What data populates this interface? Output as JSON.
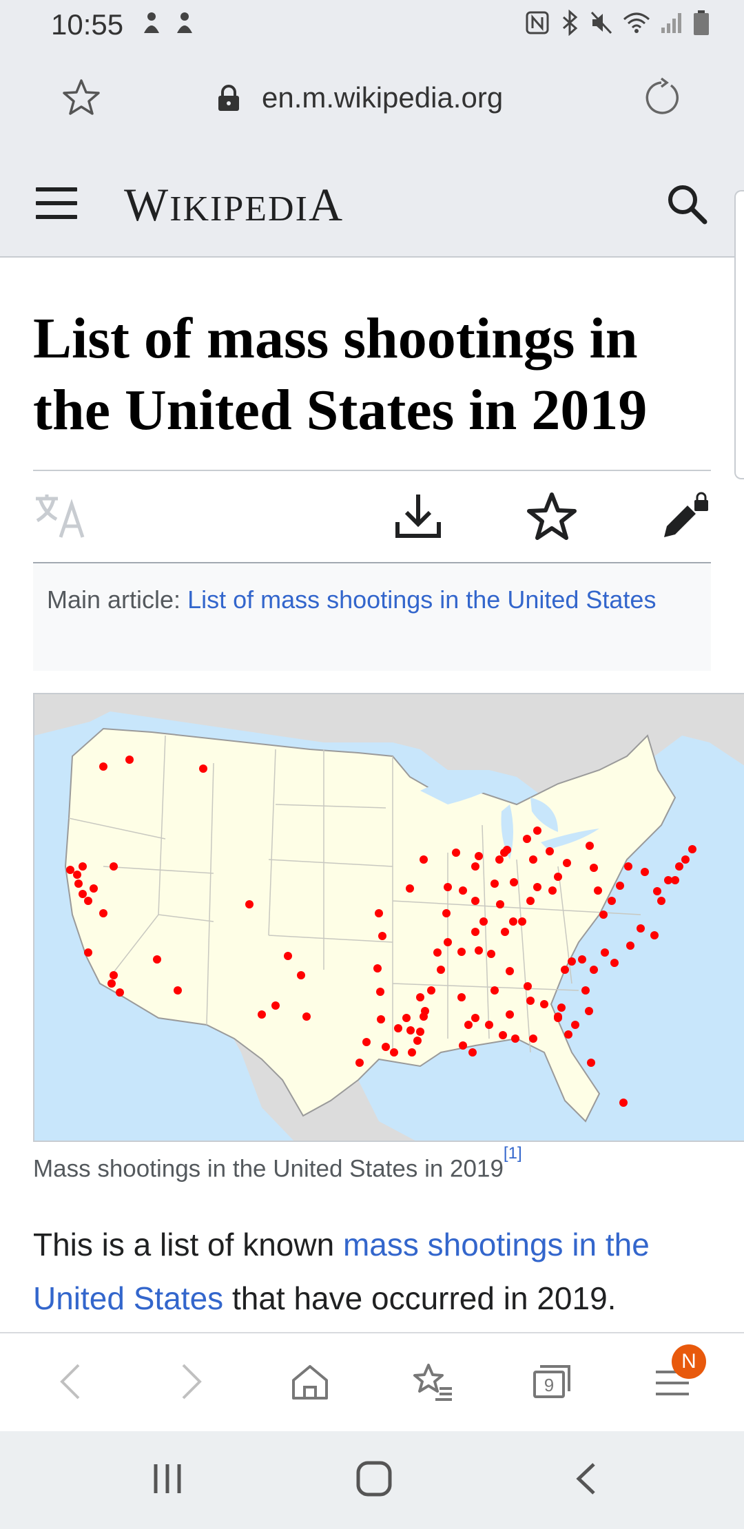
{
  "status_bar": {
    "time": "10:55",
    "left_icons": [
      "notification-icon",
      "notification-icon"
    ],
    "right_icons": [
      "nfc-icon",
      "bluetooth-icon",
      "mute-icon",
      "wifi-icon",
      "signal-icon",
      "battery-icon"
    ]
  },
  "browser": {
    "url": "en.m.wikipedia.org",
    "icons": [
      "bookmark-star-icon",
      "lock-icon",
      "reload-icon"
    ]
  },
  "wiki_header": {
    "logo_first": "W",
    "logo_rest": "IKIPEDI",
    "logo_last": "A"
  },
  "article": {
    "title": "List of mass shootings in the United States in 2019",
    "hatnote_prefix": "Main article: ",
    "hatnote_link": "List of mass shootings in the United States",
    "map_caption": "Mass shootings in the United States in 2019",
    "map_caption_ref": "[1]",
    "intro_before": "This is a list of known ",
    "intro_link": "mass shootings in the United States",
    "intro_after": " that have occurred in 2019."
  },
  "toolbar": {
    "tabs_count": "9",
    "menu_badge": "N",
    "icons": [
      "back-icon",
      "forward-icon",
      "home-icon",
      "bookmarks-icon",
      "tabs-icon",
      "menu-icon"
    ]
  },
  "colors": {
    "link": "#3366cc",
    "chrome_bg": "#eaecf0",
    "map_water": "#c8e6fb",
    "map_land": "#fefee6",
    "map_marker": "#ff0000",
    "badge": "#e8590c"
  }
}
